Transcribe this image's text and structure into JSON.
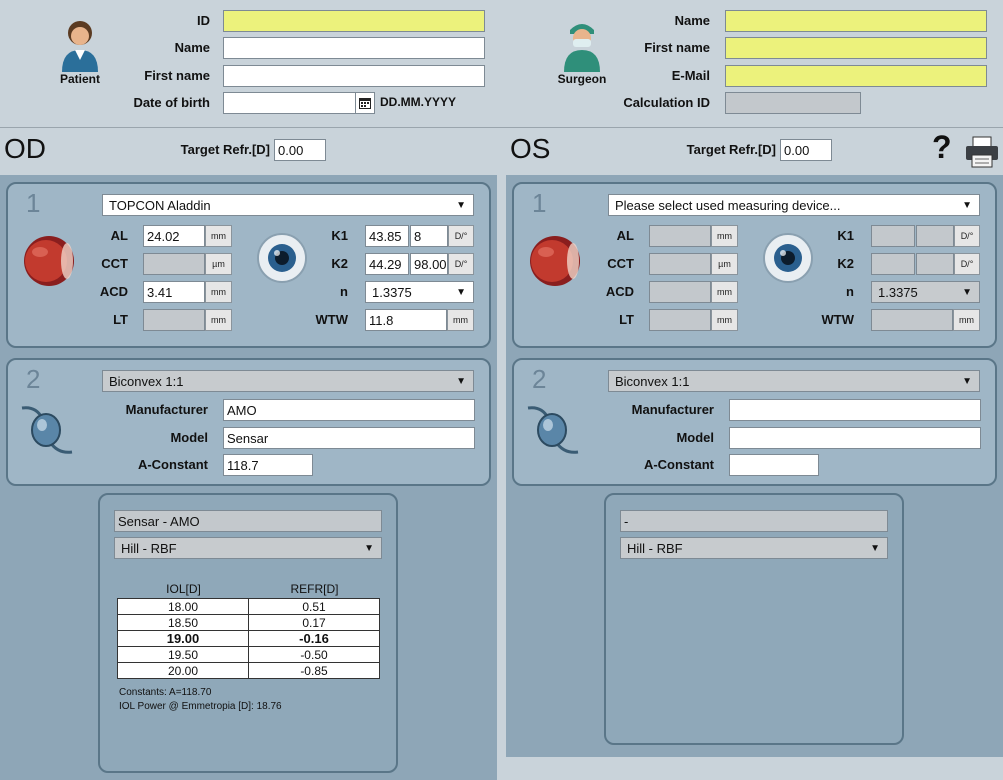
{
  "patient": {
    "icon_label": "Patient",
    "id_label": "ID",
    "id_value": "",
    "name_label": "Name",
    "name_value": "",
    "first_name_label": "First name",
    "first_name_value": "",
    "dob_label": "Date of birth",
    "dob_value": "",
    "dob_format": "DD.MM.YYYY"
  },
  "surgeon": {
    "icon_label": "Surgeon",
    "name_label": "Name",
    "name_value": "",
    "first_name_label": "First name",
    "first_name_value": "",
    "email_label": "E-Mail",
    "email_value": "",
    "calc_id_label": "Calculation ID",
    "calc_id_value": ""
  },
  "od": {
    "title": "OD",
    "target_label": "Target Refr.[D]",
    "target_value": "0.00",
    "section1_num": "1",
    "device": "TOPCON Aladdin",
    "al_label": "AL",
    "al_value": "24.02",
    "al_unit": "mm",
    "cct_label": "CCT",
    "cct_value": "",
    "cct_unit": "µm",
    "acd_label": "ACD",
    "acd_value": "3.41",
    "acd_unit": "mm",
    "lt_label": "LT",
    "lt_value": "",
    "lt_unit": "mm",
    "k1_label": "K1",
    "k1_value": "43.85",
    "k1_axis": "8",
    "k1_unit": "D/°",
    "k2_label": "K2",
    "k2_value": "44.29",
    "k2_axis": "98.00",
    "k2_unit": "D/°",
    "n_label": "n",
    "n_value": "1.3375",
    "wtw_label": "WTW",
    "wtw_value": "11.8",
    "wtw_unit": "mm",
    "section2_num": "2",
    "lens_type": "Biconvex 1:1",
    "manufacturer_label": "Manufacturer",
    "manufacturer_value": "AMO",
    "model_label": "Model",
    "model_value": "Sensar",
    "aconst_label": "A-Constant",
    "aconst_value": "118.7",
    "result_lens": "Sensar - AMO",
    "formula": "Hill - RBF",
    "col_iol": "IOL[D]",
    "col_refr": "REFR[D]",
    "rows": [
      {
        "iol": "18.00",
        "refr": "0.51"
      },
      {
        "iol": "18.50",
        "refr": "0.17"
      },
      {
        "iol": "19.00",
        "refr": "-0.16"
      },
      {
        "iol": "19.50",
        "refr": "-0.50"
      },
      {
        "iol": "20.00",
        "refr": "-0.85"
      }
    ],
    "constants_text": "Constants: A=118.70",
    "emmetropia_text": "IOL Power @ Emmetropia [D]: 18.76"
  },
  "os": {
    "title": "OS",
    "target_label": "Target Refr.[D]",
    "target_value": "0.00",
    "section1_num": "1",
    "device": "Please select used measuring device...",
    "al_label": "AL",
    "al_unit": "mm",
    "cct_label": "CCT",
    "cct_unit": "µm",
    "acd_label": "ACD",
    "acd_unit": "mm",
    "lt_label": "LT",
    "lt_unit": "mm",
    "k1_label": "K1",
    "k1_unit": "D/°",
    "k2_label": "K2",
    "k2_unit": "D/°",
    "n_label": "n",
    "n_value": "1.3375",
    "wtw_label": "WTW",
    "wtw_unit": "mm",
    "section2_num": "2",
    "lens_type": "Biconvex 1:1",
    "manufacturer_label": "Manufacturer",
    "manufacturer_value": "",
    "model_label": "Model",
    "model_value": "",
    "aconst_label": "A-Constant",
    "aconst_value": "",
    "result_lens": "-",
    "formula": "Hill - RBF"
  },
  "toolbar": {
    "help_glyph": "?",
    "help_icon": "question-mark-icon",
    "print_icon": "printer-icon"
  },
  "colors": {
    "required_field": "#ecf27c",
    "pane": "#8ea6b7",
    "section": "#9fb6c6",
    "border": "#5a7688"
  }
}
